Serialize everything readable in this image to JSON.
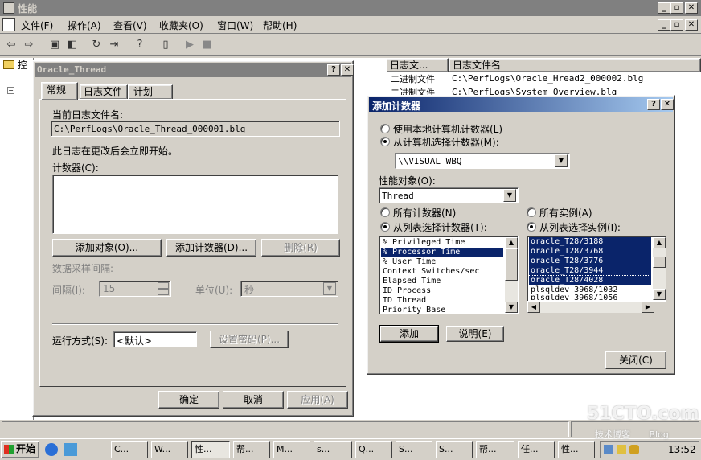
{
  "main_window": {
    "title": "性能",
    "menu": [
      "文件(F)",
      "操作(A)",
      "查看(V)",
      "收藏夹(O)",
      "窗口(W)",
      "帮助(H)"
    ],
    "tree_root": "控",
    "list_headers": [
      "日志文...",
      "日志文件名"
    ],
    "list_rows": [
      {
        "type": "二进制文件",
        "file": "C:\\PerfLogs\\Oracle_Hread2_000002.blg"
      },
      {
        "type": "二进制文件",
        "file": "C:\\PerfLogs\\System_Overview.blg"
      }
    ]
  },
  "props_dialog": {
    "title": "Oracle_Thread",
    "tabs": [
      "常规",
      "日志文件",
      "计划"
    ],
    "current_log_label": "当前日志文件名:",
    "current_log_value": "C:\\PerfLogs\\Oracle_Thread_000001.blg",
    "restart_note": "此日志在更改后会立即开始。",
    "counters_label": "计数器(C):",
    "add_objects": "添加对象(O)...",
    "add_counters": "添加计数器(D)...",
    "remove": "删除(R)",
    "sample_interval": "数据采样间隔:",
    "interval_label": "间隔(I):",
    "interval_value": "15",
    "unit_label": "单位(U):",
    "unit_value": "秒",
    "run_as_label": "运行方式(S):",
    "run_as_value": "<默认>",
    "set_password": "设置密码(P)...",
    "ok": "确定",
    "cancel": "取消",
    "apply": "应用(A)"
  },
  "add_counter_dialog": {
    "title": "添加计数器",
    "use_local": "使用本地计算机计数器(L)",
    "select_computer": "从计算机选择计数器(M):",
    "computer_value": "\\\\VISUAL_WBQ",
    "perf_object_label": "性能对象(O):",
    "perf_object_value": "Thread",
    "all_counters": "所有计数器(N)",
    "select_counters": "从列表选择计数器(T):",
    "all_instances": "所有实例(A)",
    "select_instances": "从列表选择实例(I):",
    "counters": [
      "% Privileged Time",
      "% Processor Time",
      "% User Time",
      "Context Switches/sec",
      "Elapsed Time",
      "ID Process",
      "ID Thread",
      "Priority Base"
    ],
    "instances": [
      "oracle_T28/3188",
      "oracle_T28/3768",
      "oracle_T28/3776",
      "oracle_T28/3944",
      "oracle_T28/4028",
      "plsqldev_3968/1032",
      "plsqldev_3968/1056"
    ],
    "add": "添加",
    "explain": "说明(E)",
    "close": "关闭(C)"
  },
  "taskbar": {
    "start": "开始",
    "tasks": [
      "C...",
      "W...",
      "性...",
      "帮...",
      "M...",
      "s...",
      "Q...",
      "S...",
      "S...",
      "帮...",
      "任...",
      "性..."
    ],
    "clock": "13:52"
  },
  "watermark": {
    "site": "51CTO.com",
    "sub": "技术博客",
    "blog": "Blog"
  }
}
